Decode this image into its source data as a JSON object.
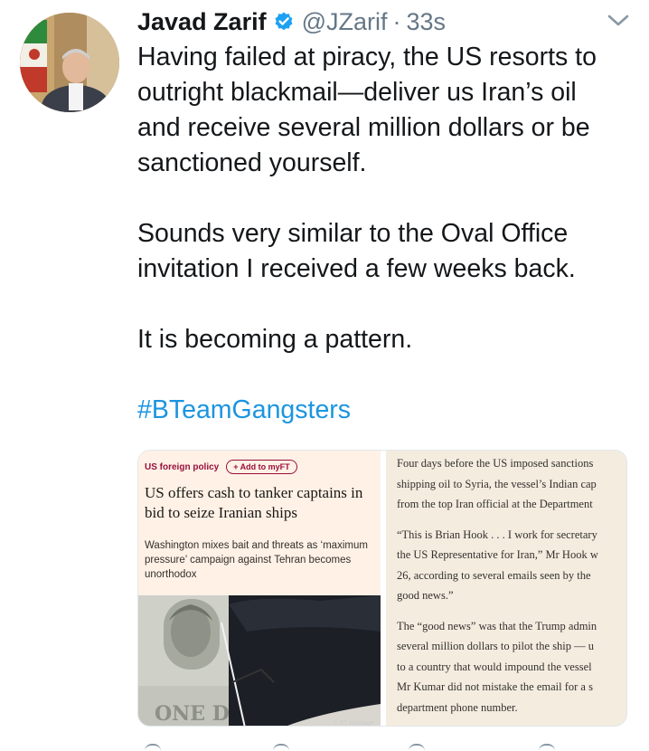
{
  "tweet": {
    "author": {
      "display_name": "Javad Zarif",
      "handle": "@JZarif",
      "verified": true
    },
    "separator": "·",
    "timestamp": "33s",
    "lines": [
      "Having failed at piracy, the US resorts to",
      "outright blackmail—deliver us Iran’s oil",
      "and receive several million dollars or be",
      "sanctioned yourself.",
      "",
      "Sounds very similar to the Oval Office",
      "invitation I received a few weeks back.",
      "",
      "It is becoming a pattern.",
      ""
    ],
    "hashtag": "#BTeamGangsters"
  },
  "media": {
    "left": {
      "topic": "US foreign policy",
      "myft_button": "+ Add to myFT",
      "headline": "US offers cash to tanker captains in bid to seize Iranian ships",
      "standfirst": "Washington mixes bait and threats as ‘maximum pressure’ campaign against Tehran becomes unorthodox",
      "image_credit": "© FT montage"
    },
    "right": {
      "paragraphs": [
        [
          "Four days before the US imposed sanctions",
          "shipping oil to Syria, the vessel’s Indian cap",
          "from the top Iran official at the Department"
        ],
        [
          "“This is Brian Hook . . . I work for secretary",
          "the US Representative for Iran,” Mr Hook w",
          "26, according to several emails seen by the",
          "good news.”"
        ],
        [
          "The “good news” was that the Trump admin",
          "several million dollars to pilot the ship — u",
          "to a country that would impound the vessel",
          "Mr Kumar did not mistake the email for a s",
          "department phone number."
        ]
      ]
    }
  },
  "colors": {
    "link": "#1b95e0",
    "verified": "#1da1f2",
    "secondary_text": "#657786",
    "ft_claret": "#990f3d",
    "ft_paper": "#fff1e5"
  },
  "icons": [
    "verified-badge-icon",
    "chevron-down-icon",
    "reply-icon",
    "retweet-icon",
    "like-icon",
    "share-icon"
  ]
}
